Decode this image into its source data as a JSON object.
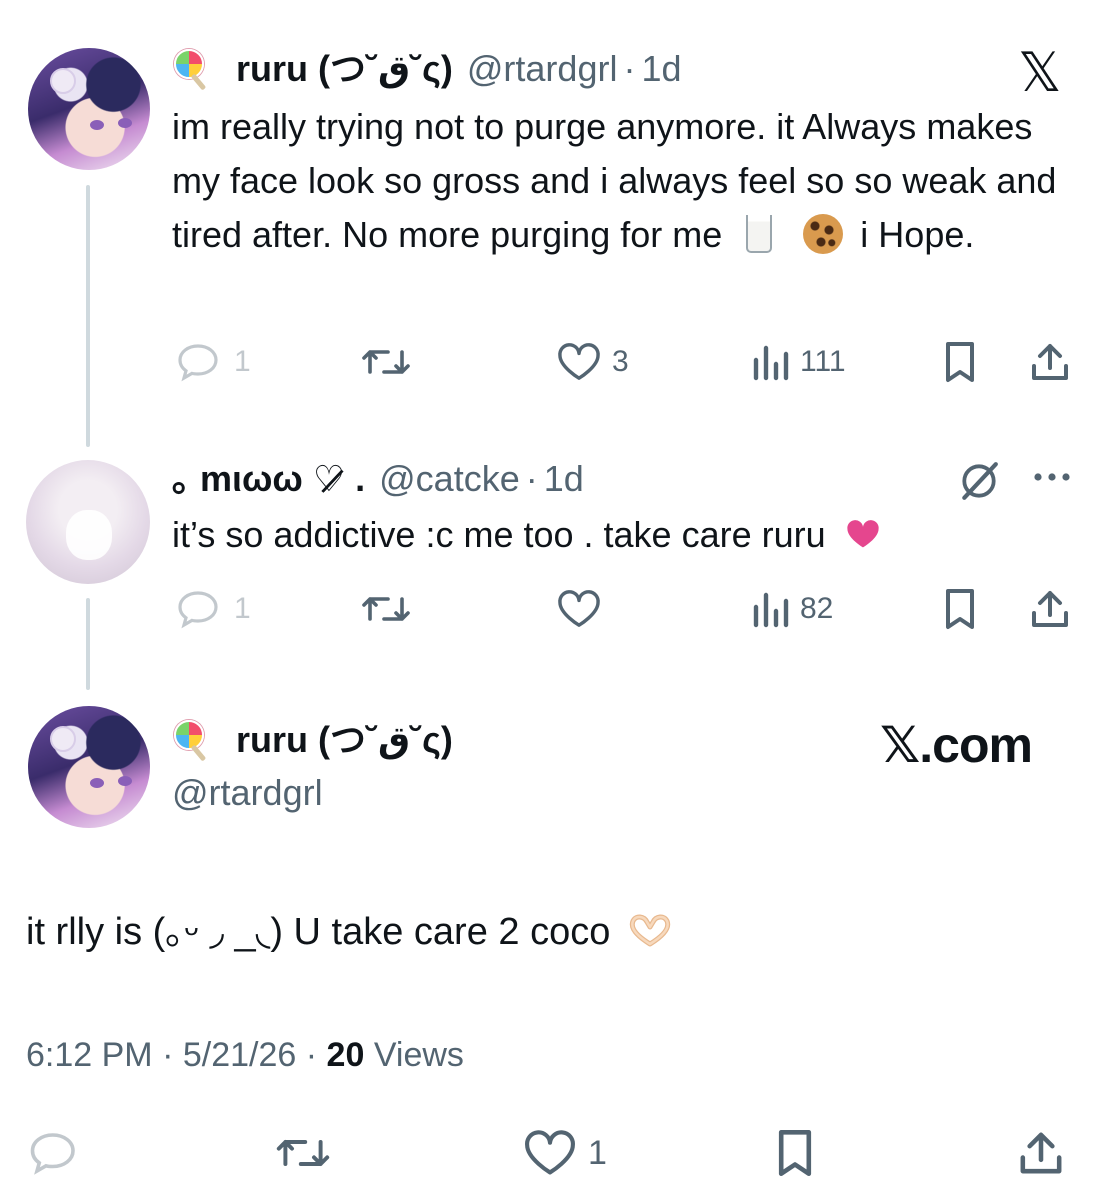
{
  "tweets": [
    {
      "display_name": "ruru (つ˘ق˘ς)",
      "handle": "@rtardgrl",
      "separator": "·",
      "time": "1d",
      "text_part1": "im really trying not to purge anymore. it Always makes my face look so gross and i always feel so so weak and tired after. No more purging for me",
      "text_part2": "i Hope.",
      "emojis": [
        "glass-of-milk",
        "cookie"
      ],
      "replies": "1",
      "likes": "3",
      "views": "111",
      "brand_mark": "𝕏"
    },
    {
      "display_name": "｡ mιωω ♡̷̷̷ .",
      "handle": "@catcke",
      "separator": "·",
      "time": "1d",
      "text": "it’s so addictive :c me too . take care ruru",
      "emojis": [
        "pink-heart"
      ],
      "replies": "1",
      "likes": "",
      "views": "82"
    }
  ],
  "main_tweet": {
    "display_name": "ruru (つ˘ق˘ς)",
    "handle": "@rtardgrl",
    "brand": "𝕏.com",
    "text": "it rlly is (｡ᵕ ◞ _◟) U take care 2 coco",
    "emojis": [
      "heart-hands"
    ],
    "time": "6:12 PM",
    "date": "5/21/26",
    "separator": "·",
    "views_count": "20",
    "views_label": "Views",
    "likes": "1"
  },
  "colors": {
    "text": "#0f1419",
    "secondary": "#536471",
    "thread_line": "#cfd9de",
    "pink_heart": "#e5468e"
  }
}
